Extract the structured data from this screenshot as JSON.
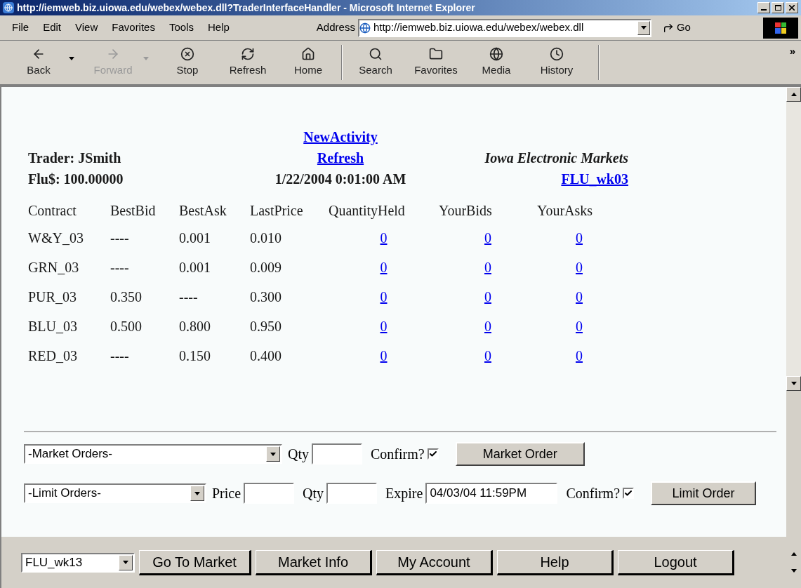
{
  "window": {
    "title": "http://iemweb.biz.uiowa.edu/webex/webex.dll?TraderInterfaceHandler - Microsoft Internet Explorer"
  },
  "menu": [
    "File",
    "Edit",
    "View",
    "Favorites",
    "Tools",
    "Help"
  ],
  "address": {
    "label": "Address",
    "value": "http://iemweb.biz.uiowa.edu/webex/webex.dll",
    "go": "Go"
  },
  "toolbar": [
    {
      "kind": "back",
      "label": "Back",
      "disabled": false,
      "dropdown": true
    },
    {
      "kind": "forward",
      "label": "Forward",
      "disabled": true,
      "dropdown": true
    },
    {
      "kind": "stop",
      "label": "Stop",
      "disabled": false,
      "dropdown": false
    },
    {
      "kind": "refresh",
      "label": "Refresh",
      "disabled": false,
      "dropdown": false
    },
    {
      "kind": "home",
      "label": "Home",
      "disabled": false,
      "dropdown": false
    },
    {
      "kind": "search",
      "label": "Search",
      "disabled": false,
      "dropdown": false
    },
    {
      "kind": "favorites",
      "label": "Favorites",
      "disabled": false,
      "dropdown": false
    },
    {
      "kind": "media",
      "label": "Media",
      "disabled": false,
      "dropdown": false
    },
    {
      "kind": "history",
      "label": "History",
      "disabled": false,
      "dropdown": false
    }
  ],
  "toolbar_more": "»",
  "header": {
    "trader": "Trader: JSmith",
    "balance": "Flu$: 100.00000",
    "links": [
      "NewActivity",
      "Refresh"
    ],
    "timestamp": "1/22/2004 0:01:00 AM",
    "market_name": "Iowa Electronic Markets",
    "market_link": "FLU_wk03"
  },
  "table": {
    "columns": [
      {
        "label": "Contract",
        "kind": "text"
      },
      {
        "label": "BestBid",
        "kind": "text"
      },
      {
        "label": "BestAsk",
        "kind": "text"
      },
      {
        "label": "LastPrice",
        "kind": "text"
      },
      {
        "label": "QuantityHeld",
        "kind": "link"
      },
      {
        "label": "YourBids",
        "kind": "link"
      },
      {
        "label": "YourAsks",
        "kind": "link"
      }
    ],
    "rows": [
      [
        "W&Y_03",
        "----",
        "0.001",
        "0.010",
        "0",
        "0",
        "0"
      ],
      [
        "GRN_03",
        "----",
        "0.001",
        "0.009",
        "0",
        "0",
        "0"
      ],
      [
        "PUR_03",
        "0.350",
        "----",
        "0.300",
        "0",
        "0",
        "0"
      ],
      [
        "BLU_03",
        "0.500",
        "0.800",
        "0.950",
        "0",
        "0",
        "0"
      ],
      [
        "RED_03",
        "----",
        "0.150",
        "0.400",
        "0",
        "0",
        "0"
      ]
    ]
  },
  "market_order": {
    "select": "-Market Orders-",
    "qty_label": "Qty",
    "confirm_label": "Confirm?",
    "confirm_checked": true,
    "button": "Market Order"
  },
  "limit_order": {
    "select": "-Limit Orders-",
    "price_label": "Price",
    "qty_label": "Qty",
    "expire_label": "Expire",
    "expire_value": "04/03/04 11:59PM",
    "confirm_label": "Confirm?",
    "confirm_checked": true,
    "button": "Limit Order"
  },
  "footer": {
    "market_select": "FLU_wk13",
    "buttons": [
      "Go To Market",
      "Market Info",
      "My Account",
      "Help",
      "Logout"
    ]
  }
}
